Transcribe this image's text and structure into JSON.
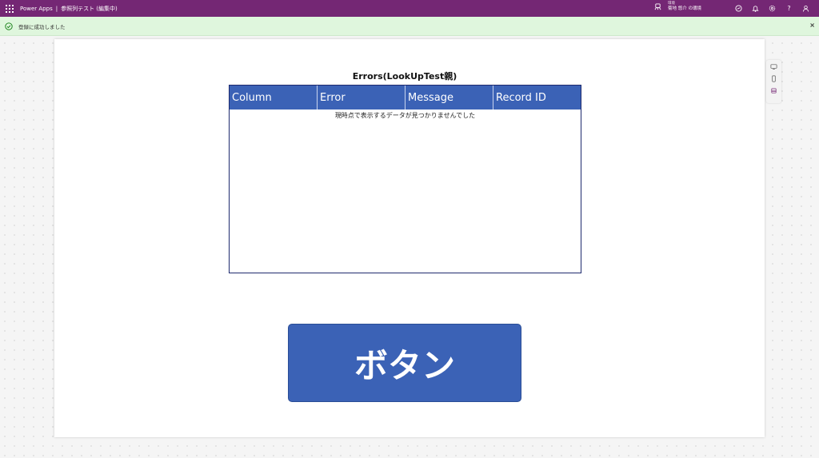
{
  "topbar": {
    "brand": "Power Apps",
    "separator": "|",
    "app_title": "参照列テスト (編集中)",
    "environment": {
      "label": "環境",
      "name": "菊地 悠介 の環境"
    },
    "icons": [
      "environment-icon",
      "copilot-icon",
      "notification-icon",
      "settings-icon",
      "help-icon",
      "account-icon"
    ],
    "help_glyph": "?"
  },
  "notification": {
    "message": "登録に成功しました",
    "close_glyph": "×",
    "color": "#dff6dd"
  },
  "canvas": {
    "table_title": "Errors(LookUpTest親)",
    "table": {
      "columns": [
        "Column",
        "Error",
        "Message",
        "Record ID"
      ],
      "empty_message": "現時点で表示するデータが見つかりませんでした"
    },
    "button_label": "ボタン"
  },
  "colors": {
    "topbar": "#742774",
    "accent": "#3b62b6",
    "table_border": "#1e2a6e"
  },
  "side_panel": {
    "icons": [
      "desktop-view-icon",
      "mobile-view-icon",
      "data-view-icon"
    ]
  }
}
